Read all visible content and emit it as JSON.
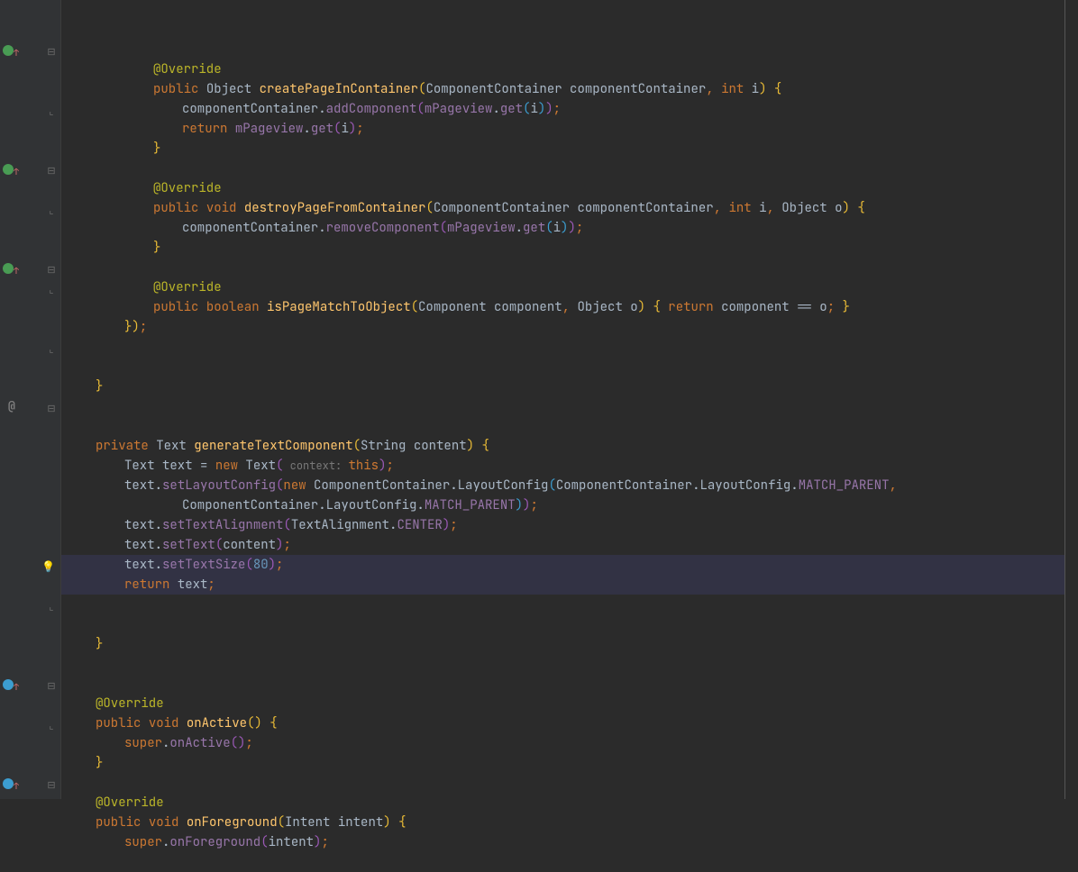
{
  "lines": [
    {
      "indent": 3,
      "type": "blank"
    },
    {
      "indent": 3,
      "tokens": [
        [
          "ann",
          "@Override"
        ]
      ]
    },
    {
      "indent": 3,
      "tokens": [
        [
          "kw",
          "public "
        ],
        [
          "cls",
          "Object "
        ],
        [
          "meth",
          "createPageInContainer"
        ],
        [
          "paren0",
          "("
        ],
        [
          "cls",
          "ComponentContainer "
        ],
        [
          "param",
          "componentContainer"
        ],
        [
          "semi",
          ", "
        ],
        [
          "kw",
          "int "
        ],
        [
          "param",
          "i"
        ],
        [
          "paren0",
          ") "
        ],
        [
          "paren0",
          "{"
        ]
      ],
      "gutter": "override-green",
      "fold": "minus"
    },
    {
      "indent": 4,
      "tokens": [
        [
          "param",
          "componentContainer"
        ],
        [
          "dot",
          "."
        ],
        [
          "mcall",
          "addComponent"
        ],
        [
          "paren1",
          "("
        ],
        [
          "field",
          "mPageview"
        ],
        [
          "dot",
          "."
        ],
        [
          "mcall",
          "get"
        ],
        [
          "paren2",
          "("
        ],
        [
          "param",
          "i"
        ],
        [
          "paren2",
          ")"
        ],
        [
          "paren1",
          ")"
        ],
        [
          "semi",
          ";"
        ]
      ]
    },
    {
      "indent": 4,
      "tokens": [
        [
          "kw",
          "return "
        ],
        [
          "field",
          "mPageview"
        ],
        [
          "dot",
          "."
        ],
        [
          "mcall",
          "get"
        ],
        [
          "paren1",
          "("
        ],
        [
          "param",
          "i"
        ],
        [
          "paren1",
          ")"
        ],
        [
          "semi",
          ";"
        ]
      ]
    },
    {
      "indent": 3,
      "tokens": [
        [
          "paren0",
          "}"
        ]
      ],
      "fold": "close"
    },
    {
      "indent": 3,
      "type": "blank"
    },
    {
      "indent": 3,
      "tokens": [
        [
          "ann",
          "@Override"
        ]
      ]
    },
    {
      "indent": 3,
      "tokens": [
        [
          "kw",
          "public "
        ],
        [
          "kw",
          "void "
        ],
        [
          "meth",
          "destroyPageFromContainer"
        ],
        [
          "paren0",
          "("
        ],
        [
          "cls",
          "ComponentContainer "
        ],
        [
          "param",
          "componentContainer"
        ],
        [
          "semi",
          ", "
        ],
        [
          "kw",
          "int "
        ],
        [
          "param",
          "i"
        ],
        [
          "semi",
          ", "
        ],
        [
          "cls",
          "Object "
        ],
        [
          "param",
          "o"
        ],
        [
          "paren0",
          ") "
        ],
        [
          "paren0",
          "{"
        ]
      ],
      "gutter": "override-green",
      "fold": "minus"
    },
    {
      "indent": 4,
      "tokens": [
        [
          "param",
          "componentContainer"
        ],
        [
          "dot",
          "."
        ],
        [
          "mcall",
          "removeComponent"
        ],
        [
          "paren1",
          "("
        ],
        [
          "field",
          "mPageview"
        ],
        [
          "dot",
          "."
        ],
        [
          "mcall",
          "get"
        ],
        [
          "paren2",
          "("
        ],
        [
          "param",
          "i"
        ],
        [
          "paren2",
          ")"
        ],
        [
          "paren1",
          ")"
        ],
        [
          "semi",
          ";"
        ]
      ]
    },
    {
      "indent": 3,
      "tokens": [
        [
          "paren0",
          "}"
        ]
      ],
      "fold": "close"
    },
    {
      "indent": 3,
      "type": "blank"
    },
    {
      "indent": 3,
      "tokens": [
        [
          "ann",
          "@Override"
        ]
      ]
    },
    {
      "indent": 3,
      "tokens": [
        [
          "kw",
          "public "
        ],
        [
          "kw",
          "boolean "
        ],
        [
          "meth",
          "isPageMatchToObject"
        ],
        [
          "paren0",
          "("
        ],
        [
          "cls",
          "Component "
        ],
        [
          "param",
          "component"
        ],
        [
          "semi",
          ", "
        ],
        [
          "cls",
          "Object "
        ],
        [
          "param",
          "o"
        ],
        [
          "paren0",
          ") "
        ],
        [
          "paren0",
          "{"
        ],
        [
          "kw",
          " return "
        ],
        [
          "param",
          "component "
        ],
        [
          "str",
          "== "
        ],
        [
          "param",
          "o"
        ],
        [
          "semi",
          "; "
        ],
        [
          "paren0",
          "}"
        ]
      ],
      "gutter": "override-green",
      "fold": "minus"
    },
    {
      "indent": 2,
      "tokens": [
        [
          "paren0",
          "}"
        ],
        [
          "paren0",
          ")"
        ],
        [
          "semi",
          ";"
        ]
      ],
      "fold": "close"
    },
    {
      "indent": 2,
      "type": "blank"
    },
    {
      "indent": 2,
      "type": "blank"
    },
    {
      "indent": 1,
      "tokens": [
        [
          "paren0",
          "}"
        ]
      ],
      "fold": "close"
    },
    {
      "indent": 1,
      "type": "blank"
    },
    {
      "indent": 1,
      "type": "blank"
    },
    {
      "indent": 1,
      "tokens": [
        [
          "kw",
          "private "
        ],
        [
          "cls",
          "Text "
        ],
        [
          "meth",
          "generateTextComponent"
        ],
        [
          "paren0",
          "("
        ],
        [
          "cls",
          "String "
        ],
        [
          "param",
          "content"
        ],
        [
          "paren0",
          ") "
        ],
        [
          "paren0",
          "{"
        ]
      ],
      "gutter": "at",
      "fold": "minus"
    },
    {
      "indent": 2,
      "tokens": [
        [
          "cls",
          "Text "
        ],
        [
          "param",
          "text "
        ],
        [
          "str",
          "= "
        ],
        [
          "kw",
          "new "
        ],
        [
          "cls",
          "Text"
        ],
        [
          "paren1",
          "("
        ],
        [
          "hint",
          " context: "
        ],
        [
          "kw",
          "this"
        ],
        [
          "paren1",
          ")"
        ],
        [
          "semi",
          ";"
        ]
      ]
    },
    {
      "indent": 2,
      "tokens": [
        [
          "param",
          "text"
        ],
        [
          "dot",
          "."
        ],
        [
          "mcall",
          "setLayoutConfig"
        ],
        [
          "paren1",
          "("
        ],
        [
          "kw",
          "new "
        ],
        [
          "cls",
          "ComponentContainer"
        ],
        [
          "dot",
          "."
        ],
        [
          "cls",
          "LayoutConfig"
        ],
        [
          "paren2",
          "("
        ],
        [
          "cls",
          "ComponentContainer"
        ],
        [
          "dot",
          "."
        ],
        [
          "cls",
          "LayoutConfig"
        ],
        [
          "dot",
          "."
        ],
        [
          "field",
          "MATCH_PARENT"
        ],
        [
          "semi",
          ","
        ]
      ]
    },
    {
      "indent": 4,
      "tokens": [
        [
          "cls",
          "ComponentContainer"
        ],
        [
          "dot",
          "."
        ],
        [
          "cls",
          "LayoutConfig"
        ],
        [
          "dot",
          "."
        ],
        [
          "field",
          "MATCH_PARENT"
        ],
        [
          "paren2",
          ")"
        ],
        [
          "paren1",
          ")"
        ],
        [
          "semi",
          ";"
        ]
      ]
    },
    {
      "indent": 2,
      "tokens": [
        [
          "param",
          "text"
        ],
        [
          "dot",
          "."
        ],
        [
          "mcall",
          "setTextAlignment"
        ],
        [
          "paren1",
          "("
        ],
        [
          "cls",
          "TextAlignment"
        ],
        [
          "dot",
          "."
        ],
        [
          "field",
          "CENTER"
        ],
        [
          "paren1",
          ")"
        ],
        [
          "semi",
          ";"
        ]
      ]
    },
    {
      "indent": 2,
      "tokens": [
        [
          "param",
          "text"
        ],
        [
          "dot",
          "."
        ],
        [
          "mcall",
          "setText"
        ],
        [
          "paren1",
          "("
        ],
        [
          "param",
          "content"
        ],
        [
          "paren1",
          ")"
        ],
        [
          "semi",
          ";"
        ]
      ]
    },
    {
      "indent": 2,
      "tokens": [
        [
          "param",
          "text"
        ],
        [
          "dot",
          "."
        ],
        [
          "mcall",
          "setTextSize"
        ],
        [
          "paren1",
          "("
        ],
        [
          "num",
          "80"
        ],
        [
          "paren1",
          ")"
        ],
        [
          "semi",
          ";"
        ]
      ]
    },
    {
      "indent": 2,
      "tokens": [
        [
          "kw",
          "return "
        ],
        [
          "param",
          "text"
        ],
        [
          "semi",
          ";"
        ]
      ]
    },
    {
      "indent": 2,
      "type": "blank",
      "highlight": true,
      "bulb": true
    },
    {
      "indent": 2,
      "type": "blank",
      "highlight": true
    },
    {
      "indent": 1,
      "tokens": [
        [
          "paren0",
          "}"
        ]
      ],
      "fold": "close"
    },
    {
      "indent": 1,
      "type": "blank"
    },
    {
      "indent": 1,
      "type": "blank"
    },
    {
      "indent": 1,
      "tokens": [
        [
          "ann",
          "@Override"
        ]
      ]
    },
    {
      "indent": 1,
      "tokens": [
        [
          "kw",
          "public "
        ],
        [
          "kw",
          "void "
        ],
        [
          "meth",
          "onActive"
        ],
        [
          "paren0",
          "("
        ],
        [
          "paren0",
          ") "
        ],
        [
          "paren0",
          "{"
        ]
      ],
      "gutter": "override-blue",
      "fold": "minus"
    },
    {
      "indent": 2,
      "tokens": [
        [
          "kw",
          "super"
        ],
        [
          "dot",
          "."
        ],
        [
          "mcall",
          "onActive"
        ],
        [
          "paren1",
          "("
        ],
        [
          "paren1",
          ")"
        ],
        [
          "semi",
          ";"
        ]
      ]
    },
    {
      "indent": 1,
      "tokens": [
        [
          "paren0",
          "}"
        ]
      ],
      "fold": "close"
    },
    {
      "indent": 1,
      "type": "blank"
    },
    {
      "indent": 1,
      "tokens": [
        [
          "ann",
          "@Override"
        ]
      ]
    },
    {
      "indent": 1,
      "tokens": [
        [
          "kw",
          "public "
        ],
        [
          "kw",
          "void "
        ],
        [
          "meth",
          "onForeground"
        ],
        [
          "paren0",
          "("
        ],
        [
          "cls",
          "Intent "
        ],
        [
          "param",
          "intent"
        ],
        [
          "paren0",
          ") "
        ],
        [
          "paren0",
          "{"
        ]
      ],
      "gutter": "override-blue",
      "fold": "minus"
    },
    {
      "indent": 2,
      "tokens": [
        [
          "kw",
          "super"
        ],
        [
          "dot",
          "."
        ],
        [
          "mcall",
          "onForeground"
        ],
        [
          "paren1",
          "("
        ],
        [
          "param",
          "intent"
        ],
        [
          "paren1",
          ")"
        ],
        [
          "semi",
          ";"
        ]
      ]
    }
  ],
  "lineHeight": 22,
  "indentWidth": 32
}
